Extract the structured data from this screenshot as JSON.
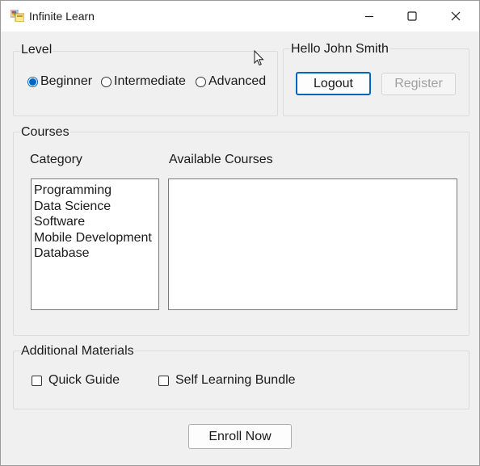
{
  "window": {
    "title": "Infinite Learn",
    "controls": [
      "minimize",
      "maximize",
      "close"
    ]
  },
  "level": {
    "group_title": "Level",
    "options": [
      {
        "label": "Beginner",
        "checked": true
      },
      {
        "label": "Intermediate",
        "checked": false
      },
      {
        "label": "Advanced",
        "checked": false
      }
    ]
  },
  "user": {
    "greeting": "Hello John Smith",
    "logout_label": "Logout",
    "register_label": "Register",
    "register_enabled": false
  },
  "courses": {
    "group_title": "Courses",
    "category_label": "Category",
    "available_label": "Available Courses",
    "categories": [
      "Programming",
      "Data Science",
      "Software",
      "Mobile Development",
      "Database"
    ],
    "available_courses": []
  },
  "materials": {
    "group_title": "Additional Materials",
    "options": [
      {
        "label": "Quick Guide",
        "checked": false
      },
      {
        "label": "Self Learning Bundle",
        "checked": false
      }
    ]
  },
  "enroll_label": "Enroll Now",
  "colors": {
    "accent": "#0067c0",
    "window_bg": "#f0f0f0",
    "titlebar_bg": "#ffffff"
  }
}
